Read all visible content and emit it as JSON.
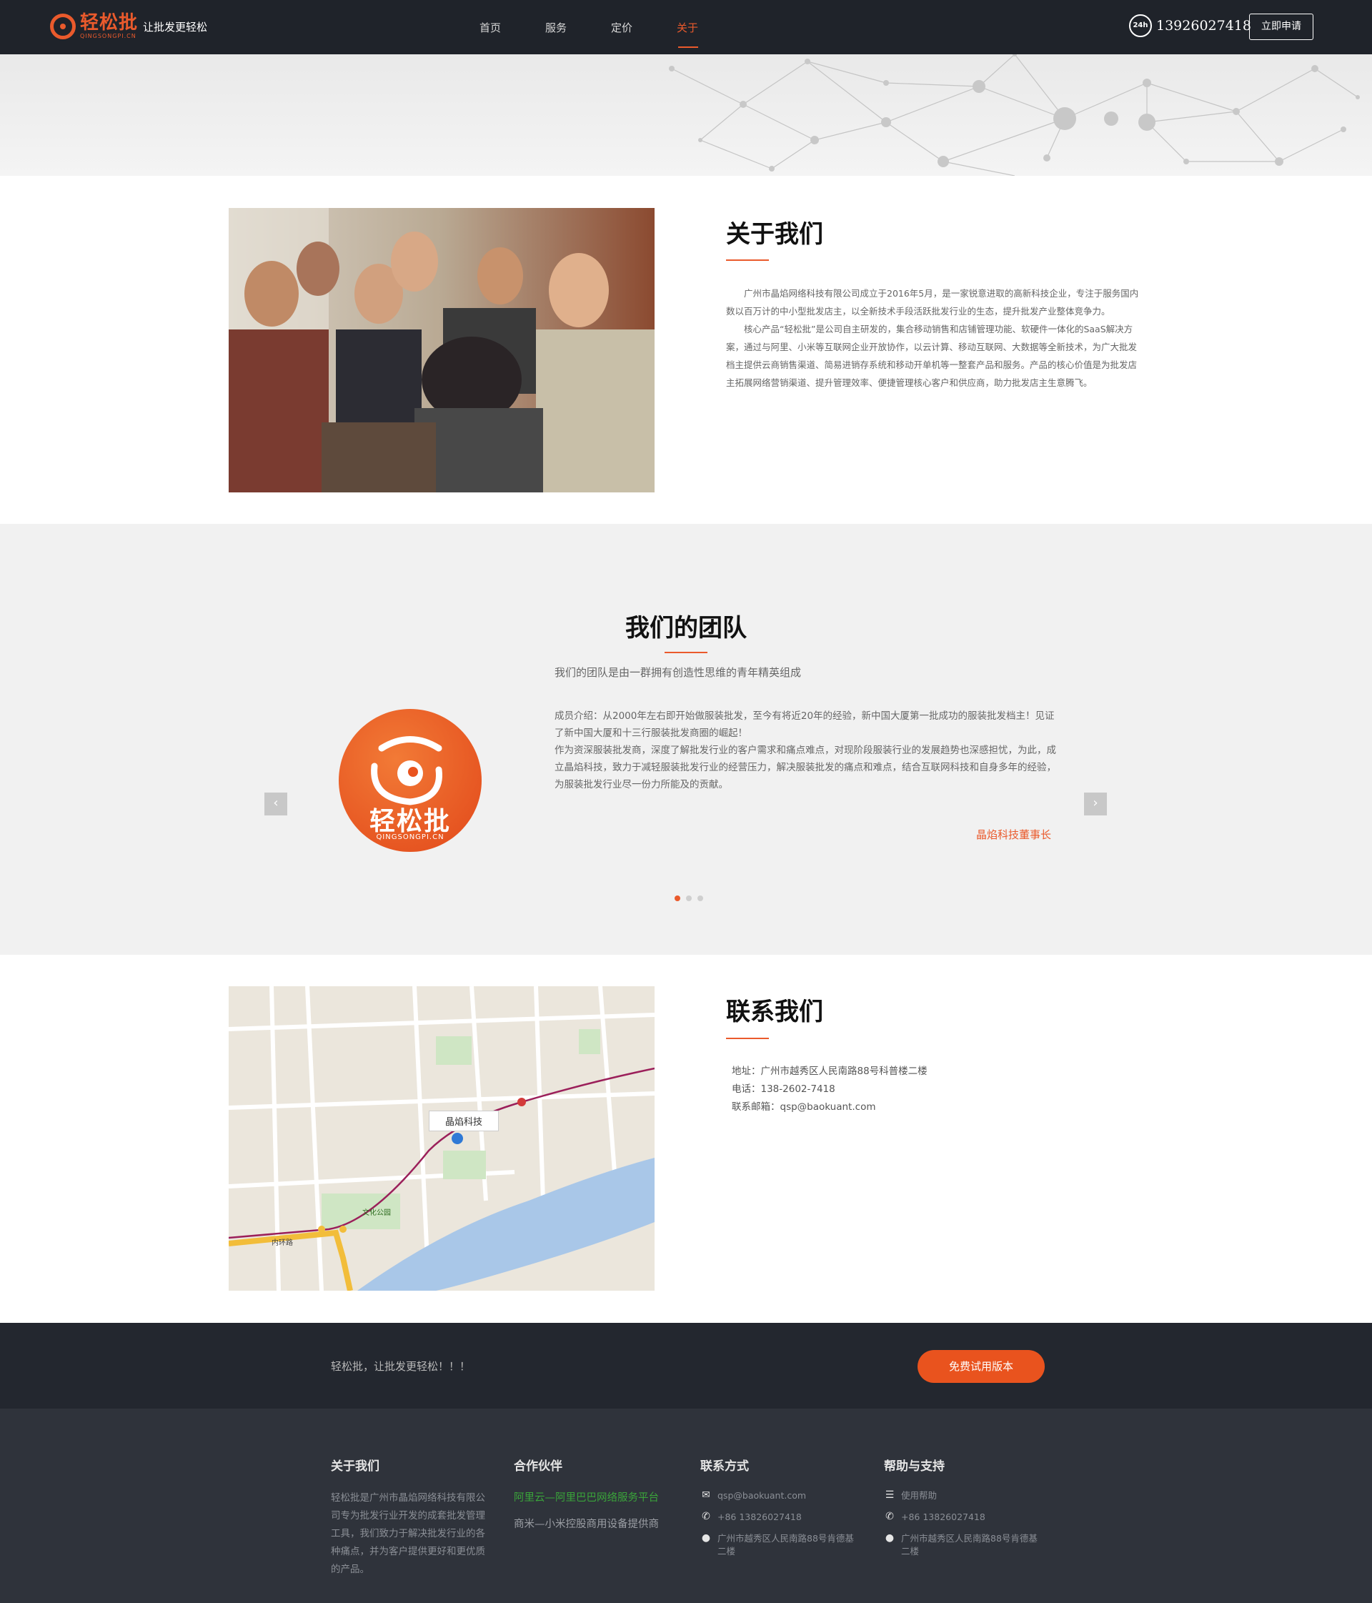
{
  "header": {
    "logo_cn": "轻松批",
    "logo_en": "QINGSONGPI.CN",
    "slogan": "让批发更轻松",
    "nav": [
      "首页",
      "服务",
      "定价",
      "关于"
    ],
    "active_nav": "关于",
    "phone_badge": "24h",
    "phone": "13926027418",
    "apply_label": "立即申请"
  },
  "about": {
    "title": "关于我们",
    "paragraphs": [
      "广州市晶焰网络科技有限公司成立于2016年5月，是一家锐意进取的高新科技企业，专注于服务国内数以百万计的中小型批发店主，以全新技术手段活跃批发行业的生态，提升批发产业整体竞争力。",
      "核心产品“轻松批”是公司自主研发的，集合移动销售和店铺管理功能、软硬件一体化的SaaS解决方案，通过与阿里、小米等互联网企业开放协作，以云计算、移动互联网、大数据等全新技术，为广大批发档主提供云商销售渠道、简易进销存系统和移动开单机等一整套产品和服务。产品的核心价值是为批发店主拓展网络营销渠道、提升管理效率、便捷管理核心客户和供应商，助力批发店主生意腾飞。"
    ]
  },
  "team": {
    "title": "我们的团队",
    "subtitle": "我们的团队是由一群拥有创造性思维的青年精英组成",
    "logo_cn": "轻松批",
    "logo_en": "QINGSONGPI.CN",
    "desc": [
      "成员介绍：从2000年左右即开始做服装批发，至今有将近20年的经验，新中国大厦第一批成功的服装批发档主！见证了新中国大厦和十三行服装批发商圈的崛起！",
      "作为资深服装批发商，深度了解批发行业的客户需求和痛点难点，对现阶段服装行业的发展趋势也深感担忧，为此，成立晶焰科技，致力于减轻服装批发行业的经营压力，解决服装批发的痛点和难点，结合互联网科技和自身多年的经验，为服装批发行业尽一份力所能及的贡献。"
    ],
    "signature": "晶焰科技董事长",
    "prev": "‹",
    "next": "›",
    "slides": 3,
    "active_slide": 0
  },
  "contact": {
    "title": "联系我们",
    "map_label": "晶焰科技",
    "map_park": "文化公园",
    "map_road": "内环路",
    "address": "地址：广州市越秀区人民南路88号科普楼二楼",
    "phone": "电话：138-2602-7418",
    "email": "联系邮箱：qsp@baokuant.com"
  },
  "cta": {
    "text": "轻松批，让批发更轻松！！！",
    "button": "免费试用版本"
  },
  "footer": {
    "about_title": "关于我们",
    "about_text": "轻松批是广州市晶焰网络科技有限公司专为批发行业开发的成套批发管理工具，我们致力于解决批发行业的各种痛点，并为客户提供更好和更优质的产品。",
    "partners_title": "合作伙伴",
    "partner_1": "阿里云—阿里巴巴网络服务平台",
    "partner_2": "商米—小米控股商用设备提供商",
    "contact_title": "联系方式",
    "contact_email": "qsp@baokuant.com",
    "contact_phone": "+86 13826027418",
    "contact_address": "广州市越秀区人民南路88号肯德基二楼",
    "help_title": "帮助与支持",
    "help_link": "使用帮助",
    "help_phone": "+86 13826027418",
    "help_address": "广州市越秀区人民南路88号肯德基二楼"
  }
}
